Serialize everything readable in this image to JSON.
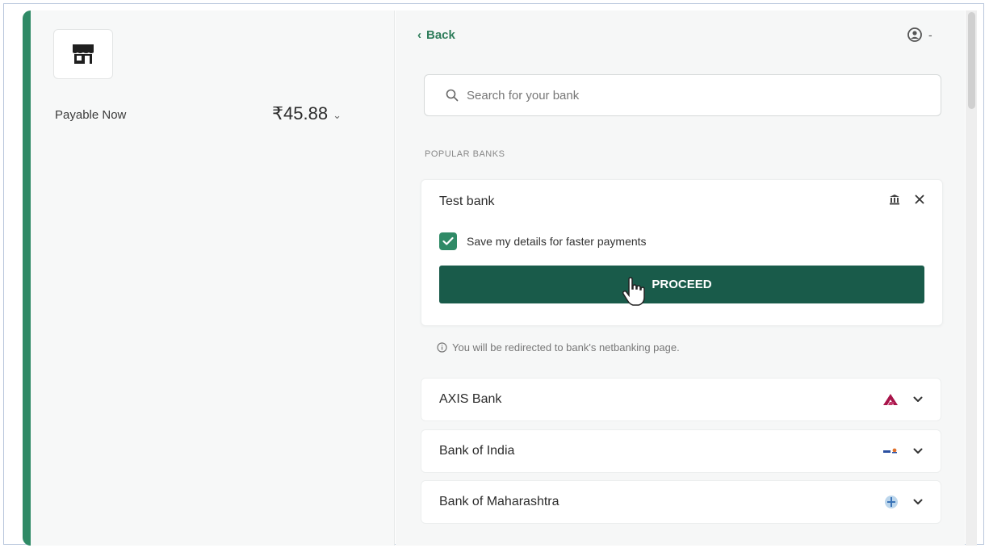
{
  "summary": {
    "payable_label": "Payable Now",
    "amount": "₹45.88",
    "amount_chevron": "⌄"
  },
  "header": {
    "back_label": "Back",
    "back_icon": "‹",
    "account_chevron": "-"
  },
  "search": {
    "placeholder": "Search for your bank"
  },
  "popular_banks": {
    "section_title": "POPULAR BANKS",
    "selected": {
      "name": "Test bank",
      "save_details_label": "Save my details for faster payments",
      "save_details_checked": true,
      "proceed_label": "PROCEED"
    },
    "info_text": "You will be redirected to bank's netbanking page.",
    "banks": [
      {
        "name": "AXIS Bank"
      },
      {
        "name": "Bank of India"
      },
      {
        "name": "Bank of Maharashtra"
      }
    ]
  },
  "colors": {
    "accent": "#2f8a66",
    "proceed_button": "#195b4a",
    "axis_logo": "#a8144a"
  },
  "icons": {
    "logo": "store-icon",
    "search": "search-icon",
    "account": "user-icon",
    "bank": "bank-icon",
    "close": "close-icon",
    "info": "info-icon"
  }
}
